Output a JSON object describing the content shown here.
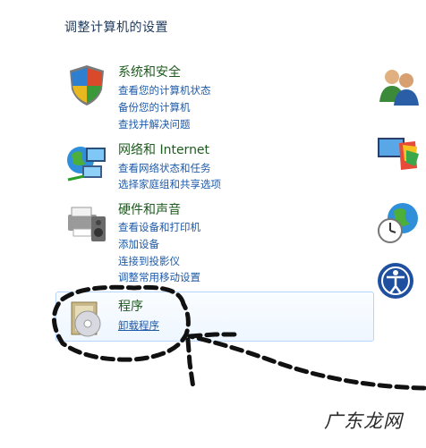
{
  "page_title": "调整计算机的设置",
  "categories": [
    {
      "title": "系统和安全",
      "icon": "shield-icon",
      "links": [
        "查看您的计算机状态",
        "备份您的计算机",
        "查找并解决问题"
      ]
    },
    {
      "title": "网络和 Internet",
      "icon": "network-globe-icon",
      "links": [
        "查看网络状态和任务",
        "选择家庭组和共享选项"
      ]
    },
    {
      "title": "硬件和声音",
      "icon": "printer-speaker-icon",
      "links": [
        "查看设备和打印机",
        "添加设备",
        "连接到投影仪",
        "调整常用移动设置"
      ]
    },
    {
      "title": "程序",
      "icon": "programs-disc-icon",
      "links": [
        "卸载程序"
      ]
    }
  ],
  "right_icons": [
    "user-accounts-icon",
    "appearance-icon",
    "clock-globe-icon",
    "ease-of-access-icon"
  ],
  "watermark": "广东龙网",
  "colors": {
    "title": "#1e395b",
    "category_title": "#1e5b1e",
    "link": "#1e5aa8",
    "annotation": "#111111"
  }
}
